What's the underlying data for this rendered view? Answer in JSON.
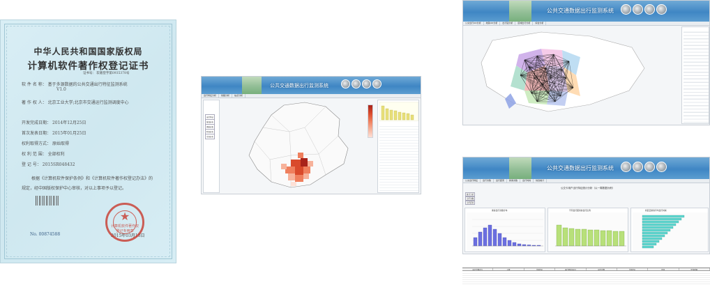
{
  "certificate": {
    "title_line1": "中华人民共和国国家版权局",
    "title_line2": "计算机软件著作权登记证书",
    "cert_no": "证书号：   软著登字第0935378号",
    "rows": [
      {
        "label": "软 件 名 称：",
        "value": "基于多源数据的公共交通出行特征监测系统"
      },
      {
        "label": "",
        "value": "V1.0"
      },
      {
        "label": "著 作 权 人：",
        "value": "北京工业大学;北京市交通运行监测调度中心"
      },
      {
        "label": "开发完成日期：",
        "value": "2014年12月25日"
      },
      {
        "label": "首次发表日期：",
        "value": "2015年01月25日"
      },
      {
        "label": "权利取得方式：",
        "value": "原始取得"
      },
      {
        "label": "权 利 范 围：",
        "value": "全部权利"
      },
      {
        "label": "登  记  号：",
        "value": "2015SR048432"
      }
    ],
    "body_line1": "根据《计算机软件保护条例》和《计算机软件著作权登记办法》的",
    "body_line2": "规定，经中国版权保护中心审核，对以上事项予以登记。",
    "serial_label": "No.",
    "serial_value": "00874588",
    "issue_date": "2015年03月18日",
    "seal_text_top": "中华人民共和国国家版权局",
    "seal_text_mid": "计算机软件著作权",
    "seal_text_bot": "登记专用章"
  },
  "app_common": {
    "system_title": "公共交通数据出行监测系统",
    "brand_colors": {
      "banner": "#3f86c4",
      "accent_red": "#d94a2b",
      "panel_border": "#cfd5dc"
    }
  },
  "app1": {
    "tabs": [
      "出行特征分析",
      "线路分析",
      "站点分析"
    ],
    "left_menu": [
      "出行特征",
      "客流分布",
      "换乘分析",
      "时间分布",
      "空间分布"
    ],
    "legend_colors": [
      "#fde0d6",
      "#f7b29a",
      "#ef7f5d",
      "#d94a2b",
      "#a8231a"
    ],
    "table_rows": 24
  },
  "app2": {
    "tabs": [
      "公交出行OD分析",
      "地铁OD分析",
      "出行链分析",
      "区域出行分析",
      "综合分析"
    ],
    "side_list_rows": 28
  },
  "app3": {
    "tabs": [
      "公交出行特征",
      "出行次数",
      "出行距离",
      "换乘次数",
      "出行时耗",
      "综合统计"
    ],
    "header_note": "公交卡用户出行特征统计分析（以一周数据为例）",
    "left_buttons": [
      "统计分析",
      "出行次数",
      "出行距离"
    ],
    "chart_titles": [
      "乘客出行次数分布",
      "不同出行距离的出行比例",
      "各区县乘客平均出行时耗"
    ],
    "table_headers": [
      "出行次数(次)",
      "人数",
      "比例(%)",
      "出行距离(km)",
      "出行次数",
      "比例(%)",
      "区县",
      "平均时耗"
    ]
  }
}
